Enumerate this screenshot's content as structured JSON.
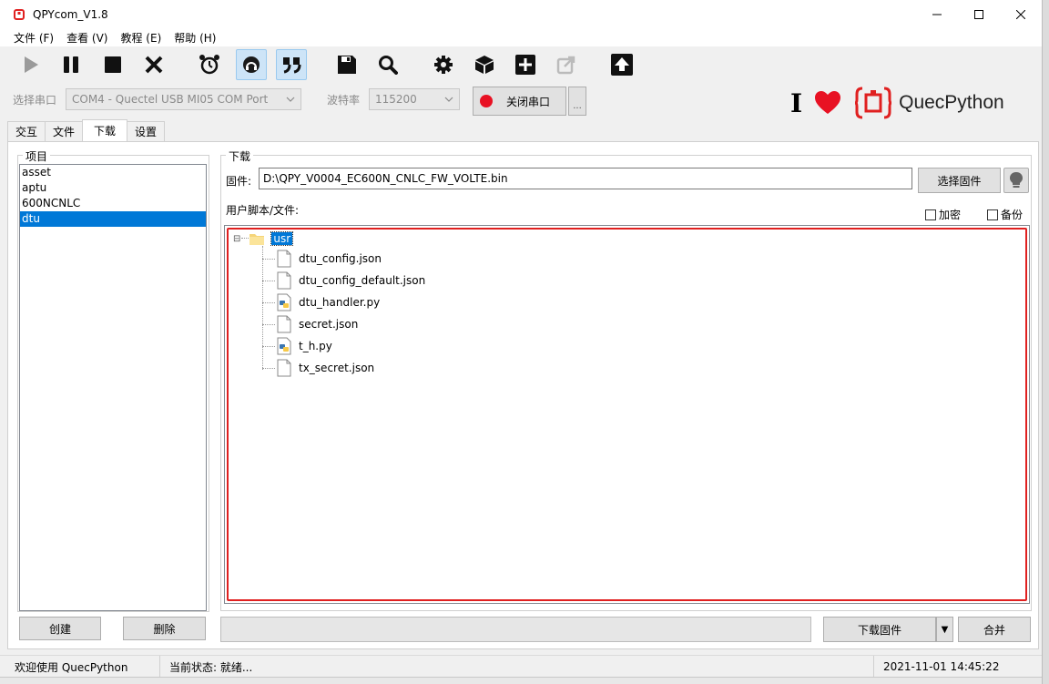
{
  "window": {
    "title": "QPYcom_V1.8",
    "minimize_label": "—",
    "maximize_label": "☐",
    "close_label": "✕"
  },
  "menu": [
    {
      "label": "文件 (F)"
    },
    {
      "label": "查看 (V)"
    },
    {
      "label": "教程 (E)"
    },
    {
      "label": "帮助 (H)"
    }
  ],
  "toolbar": {
    "icons": [
      "play-icon",
      "pause-icon",
      "stop-icon",
      "close-x-icon",
      "alarm-clock-icon",
      "headset-icon",
      "quote-icon",
      "save-icon",
      "search-icon",
      "gear-icon",
      "cube-icon",
      "add-icon",
      "share-icon",
      "upload-icon"
    ]
  },
  "port": {
    "port_label": "选择串口",
    "port_value": "COM4 - Quectel USB MI05 COM Port",
    "baud_label": "波特率",
    "baud_value": "115200",
    "close_port_label": "关闭串口",
    "more_label": "...",
    "record_color": "#e81123"
  },
  "brand": {
    "cursor_text": "I",
    "name": "QuecPython",
    "heart_color": "#e81123",
    "logo_color": "#e02020"
  },
  "tabs": [
    {
      "label": "交互"
    },
    {
      "label": "文件"
    },
    {
      "label": "下载"
    },
    {
      "label": "设置"
    }
  ],
  "project": {
    "title": "项目",
    "items": [
      "asset",
      "aptu",
      "600NCNLC",
      "dtu"
    ],
    "selected": "dtu",
    "create_label": "创建",
    "delete_label": "删除"
  },
  "download": {
    "title": "下载",
    "firmware_label": "固件:",
    "firmware_path": "D:\\QPY_V0004_EC600N_CNLC_FW_VOLTE.bin",
    "choose_firmware_label": "选择固件",
    "user_script_label": "用户脚本/文件:",
    "encrypt_label": "加密",
    "backup_label": "备份",
    "tree_root": "usr",
    "tree_expander": "⊟",
    "files": [
      {
        "name": "dtu_config.json",
        "kind": "file"
      },
      {
        "name": "dtu_config_default.json",
        "kind": "file"
      },
      {
        "name": "dtu_handler.py",
        "kind": "python"
      },
      {
        "name": "secret.json",
        "kind": "file"
      },
      {
        "name": "t_h.py",
        "kind": "python"
      },
      {
        "name": "tx_secret.json",
        "kind": "file"
      }
    ],
    "download_firmware_label": "下载固件",
    "dropdown_arrow": "▼",
    "merge_label": "合并"
  },
  "status": {
    "welcome": "欢迎使用 QuecPython",
    "state": "当前状态: 就绪...",
    "datetime": "2021-11-01 14:45:22"
  }
}
